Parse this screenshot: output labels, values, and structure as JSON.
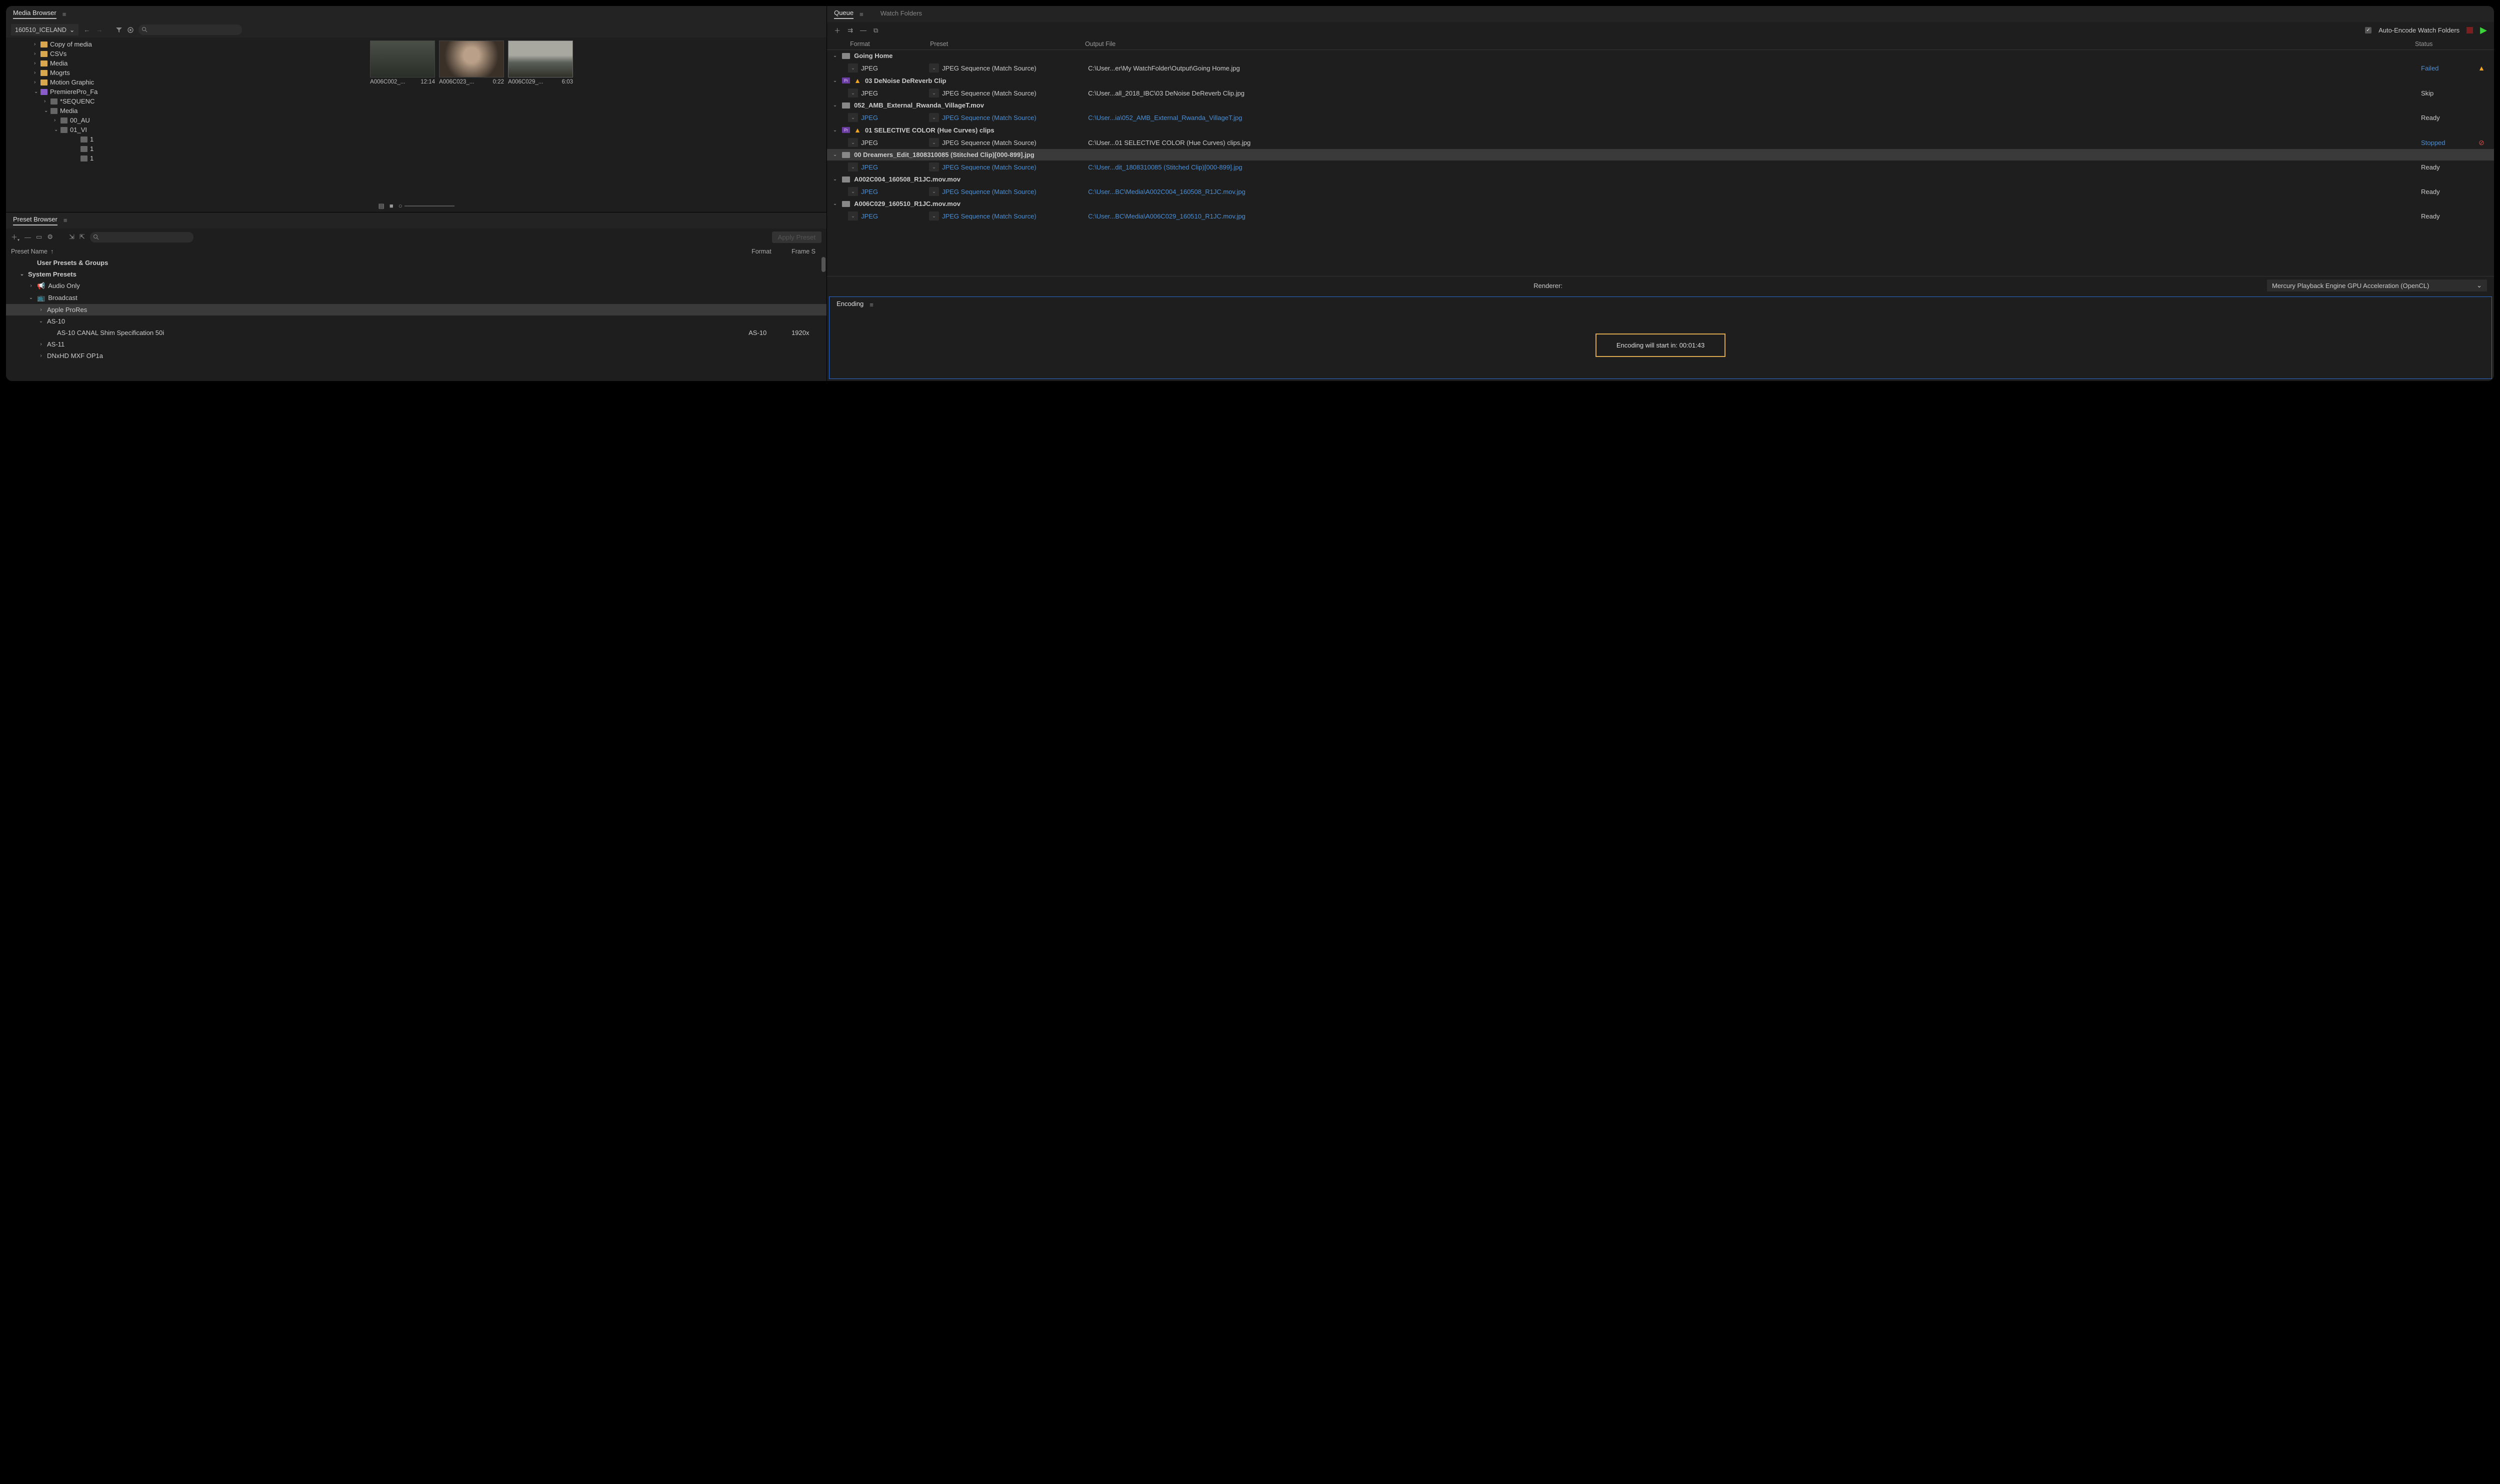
{
  "media_browser": {
    "title": "Media Browser",
    "dropdown": "160510_ICELAND",
    "tree": [
      {
        "pad": 56,
        "chev": "›",
        "ico": "folder",
        "label": "Copy of media"
      },
      {
        "pad": 56,
        "chev": "›",
        "ico": "folder",
        "label": "CSVs"
      },
      {
        "pad": 56,
        "chev": "›",
        "ico": "folder",
        "label": "Media"
      },
      {
        "pad": 56,
        "chev": "›",
        "ico": "folder",
        "label": "Mogrts"
      },
      {
        "pad": 56,
        "chev": "›",
        "ico": "folder",
        "label": "Motion Graphic"
      },
      {
        "pad": 56,
        "chev": "⌄",
        "ico": "pr",
        "label": "PremierePro_Fa"
      },
      {
        "pad": 76,
        "chev": "›",
        "ico": "folderg",
        "label": "*SEQUENC"
      },
      {
        "pad": 76,
        "chev": "⌄",
        "ico": "folderg",
        "label": "Media"
      },
      {
        "pad": 96,
        "chev": "›",
        "ico": "folderg",
        "label": "00_AU"
      },
      {
        "pad": 96,
        "chev": "⌄",
        "ico": "folderg",
        "label": "01_VI"
      },
      {
        "pad": 136,
        "chev": "",
        "ico": "folderg",
        "label": "1"
      },
      {
        "pad": 136,
        "chev": "",
        "ico": "folderg",
        "label": "1"
      },
      {
        "pad": 136,
        "chev": "",
        "ico": "folderg",
        "label": "1"
      }
    ],
    "thumbs": [
      {
        "name": "A006C002_...",
        "dur": "12:14",
        "scene": "scene-a"
      },
      {
        "name": "A006C023_...",
        "dur": "0:22",
        "scene": "scene-b"
      },
      {
        "name": "A006C029_...",
        "dur": "6:03",
        "scene": "scene-c",
        "selected": true
      }
    ]
  },
  "preset_browser": {
    "title": "Preset Browser",
    "apply": "Apply Preset",
    "h_name": "Preset Name",
    "h_format": "Format",
    "h_frame": "Frame S",
    "rows": [
      {
        "pad": 28,
        "chev": "",
        "label": "User Presets & Groups",
        "bold": true
      },
      {
        "pad": 10,
        "chev": "⌄",
        "label": "System Presets",
        "bold": true
      },
      {
        "pad": 28,
        "chev": "›",
        "label": "Audio Only",
        "icon": "audio"
      },
      {
        "pad": 28,
        "chev": "⌄",
        "label": "Broadcast",
        "icon": "tv"
      },
      {
        "pad": 48,
        "chev": "›",
        "label": "Apple ProRes",
        "selected": true
      },
      {
        "pad": 48,
        "chev": "⌄",
        "label": "AS-10"
      },
      {
        "pad": 68,
        "chev": "",
        "label": "AS-10 CANAL Shim Specification 50i",
        "fmt": "AS-10",
        "fs": "1920x"
      },
      {
        "pad": 48,
        "chev": "›",
        "label": "AS-11"
      },
      {
        "pad": 48,
        "chev": "›",
        "label": "DNxHD MXF OP1a"
      }
    ]
  },
  "queue": {
    "tab_queue": "Queue",
    "tab_watch": "Watch Folders",
    "auto_encode": "Auto-Encode Watch Folders",
    "h_format": "Format",
    "h_preset": "Preset",
    "h_output": "Output File",
    "h_status": "Status",
    "items": [
      {
        "type": "group",
        "ico": "clip",
        "label": "Going Home"
      },
      {
        "type": "row",
        "fmt": "JPEG",
        "preset": "JPEG Sequence (Match Source)",
        "out": "C:\\User...er\\My WatchFolder\\Output\\Going Home.jpg",
        "status": "Failed",
        "statusCls": "status-failed",
        "end": "warn"
      },
      {
        "type": "group",
        "ico": "pr",
        "warn": true,
        "label": "03 DeNoise DeReverb Clip"
      },
      {
        "type": "row",
        "fmt": "JPEG",
        "preset": "JPEG Sequence (Match Source)",
        "out": "C:\\User...all_2018_IBC\\03 DeNoise DeReverb Clip.jpg",
        "status": "Skip"
      },
      {
        "type": "group",
        "ico": "clip",
        "label": "052_AMB_External_Rwanda_VillageT.mov"
      },
      {
        "type": "row",
        "link": true,
        "fmt": "JPEG",
        "preset": "JPEG Sequence (Match Source)",
        "out": "C:\\User...ia\\052_AMB_External_Rwanda_VillageT.jpg",
        "status": "Ready"
      },
      {
        "type": "group",
        "ico": "pr",
        "warn": true,
        "label": "01 SELECTIVE COLOR (Hue Curves) clips"
      },
      {
        "type": "row",
        "fmt": "JPEG",
        "preset": "JPEG Sequence (Match Source)",
        "out": "C:\\User...01 SELECTIVE COLOR (Hue Curves) clips.jpg",
        "status": "Stopped",
        "statusCls": "status-stopped",
        "end": "stop"
      },
      {
        "type": "group",
        "ico": "clip",
        "selected": true,
        "label": "00 Dreamers_Edit_1808310085 (Stitched Clip)[000-899].jpg"
      },
      {
        "type": "row",
        "link": true,
        "fmt": "JPEG",
        "preset": "JPEG Sequence (Match Source)",
        "out": "C:\\User...dit_1808310085 (Stitched Clip)[000-899].jpg",
        "status": "Ready"
      },
      {
        "type": "group",
        "ico": "clip",
        "label": "A002C004_160508_R1JC.mov.mov"
      },
      {
        "type": "row",
        "link": true,
        "fmt": "JPEG",
        "preset": "JPEG Sequence (Match Source)",
        "out": "C:\\User...BC\\Media\\A002C004_160508_R1JC.mov.jpg",
        "status": "Ready"
      },
      {
        "type": "group",
        "ico": "clip",
        "label": "A006C029_160510_R1JC.mov.mov"
      },
      {
        "type": "row",
        "link": true,
        "fmt": "JPEG",
        "preset": "JPEG Sequence (Match Source)",
        "out": "C:\\User...BC\\Media\\A006C029_160510_R1JC.mov.jpg",
        "status": "Ready"
      }
    ],
    "renderer_label": "Renderer:",
    "renderer_value": "Mercury Playback Engine GPU Acceleration (OpenCL)"
  },
  "encoding": {
    "title": "Encoding",
    "message": "Encoding will start in: 00:01:43"
  }
}
